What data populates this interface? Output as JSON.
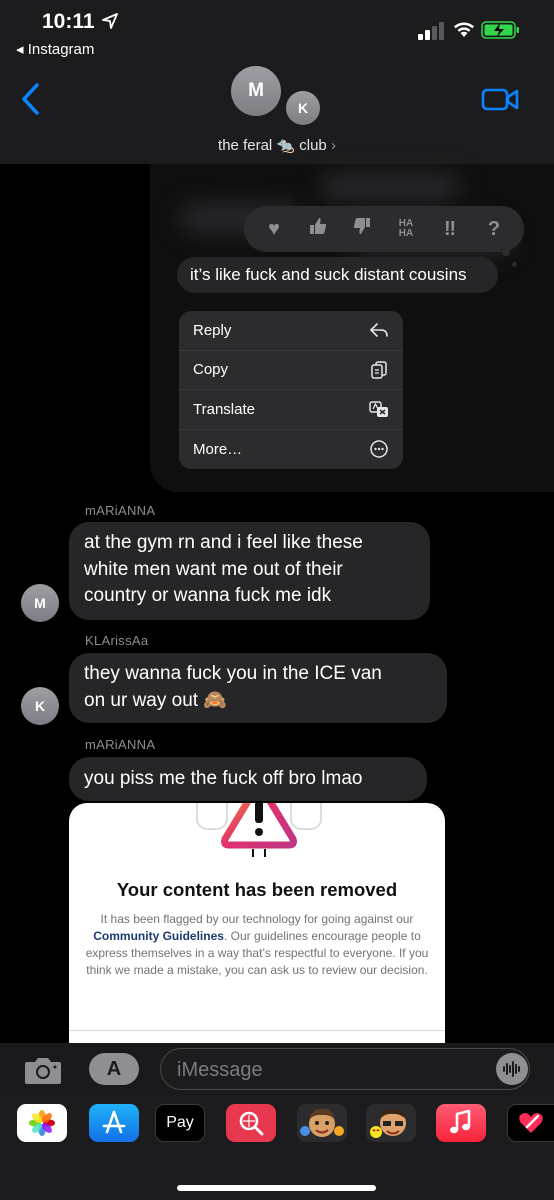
{
  "status_bar": {
    "time": "10:11",
    "back_app": "◂ Instagram"
  },
  "header": {
    "avatar_m": "M",
    "avatar_k": "K",
    "group_name": "the feral 🐀 club",
    "chevron": "›"
  },
  "tapback": {
    "heart": "♥",
    "thumbs_up": "👍",
    "thumbs_down": "👎",
    "haha_top": "HA",
    "haha_bottom": "HA",
    "exclaim": "‼",
    "question": "?"
  },
  "selected_message": "it’s like fuck and suck distant cousins",
  "context_menu": {
    "items": [
      {
        "label": "Reply",
        "icon": "reply-icon"
      },
      {
        "label": "Copy",
        "icon": "copy-icon"
      },
      {
        "label": "Translate",
        "icon": "translate-icon"
      },
      {
        "label": "More…",
        "icon": "more-icon"
      }
    ]
  },
  "messages": [
    {
      "sender": "mARiANNA",
      "avatar": "M",
      "text_lines": [
        "at the gym rn and i feel like these",
        "white men want me out of their",
        "country or wanna fuck me idk"
      ]
    },
    {
      "sender": "KLArissAa",
      "avatar": "K",
      "text_lines": [
        "they wanna fuck you in the ICE van",
        "on ur way out 🙈"
      ]
    },
    {
      "sender": "mARiANNA",
      "text_lines": [
        "you piss me the fuck off bro lmao"
      ]
    }
  ],
  "removed_card": {
    "title": "Your content has been removed",
    "body_before": "It has been flagged by our technology for going against our",
    "link": "Community Guidelines",
    "body_after": ". Our guidelines encourage people to express themselves in a way that’s respectful to everyone. If you think we made a mistake, you can ask us to review our decision."
  },
  "input_bar": {
    "placeholder": "iMessage",
    "apps_label": "A"
  },
  "app_strip": {
    "apple_pay": "Pay",
    "apple_logo": "",
    "apps": [
      "photos-icon",
      "app-store-icon",
      "apple-pay-icon",
      "image-search-icon",
      "memoji-icon",
      "animoji-icon",
      "music-icon",
      "digital-touch-icon"
    ]
  },
  "colors": {
    "background": "#000000",
    "header": "#1c1c1e",
    "bubble": "#262628",
    "accent_blue": "#0a84ff",
    "battery_green": "#32d74b",
    "music_red": "#fa3c4c"
  }
}
